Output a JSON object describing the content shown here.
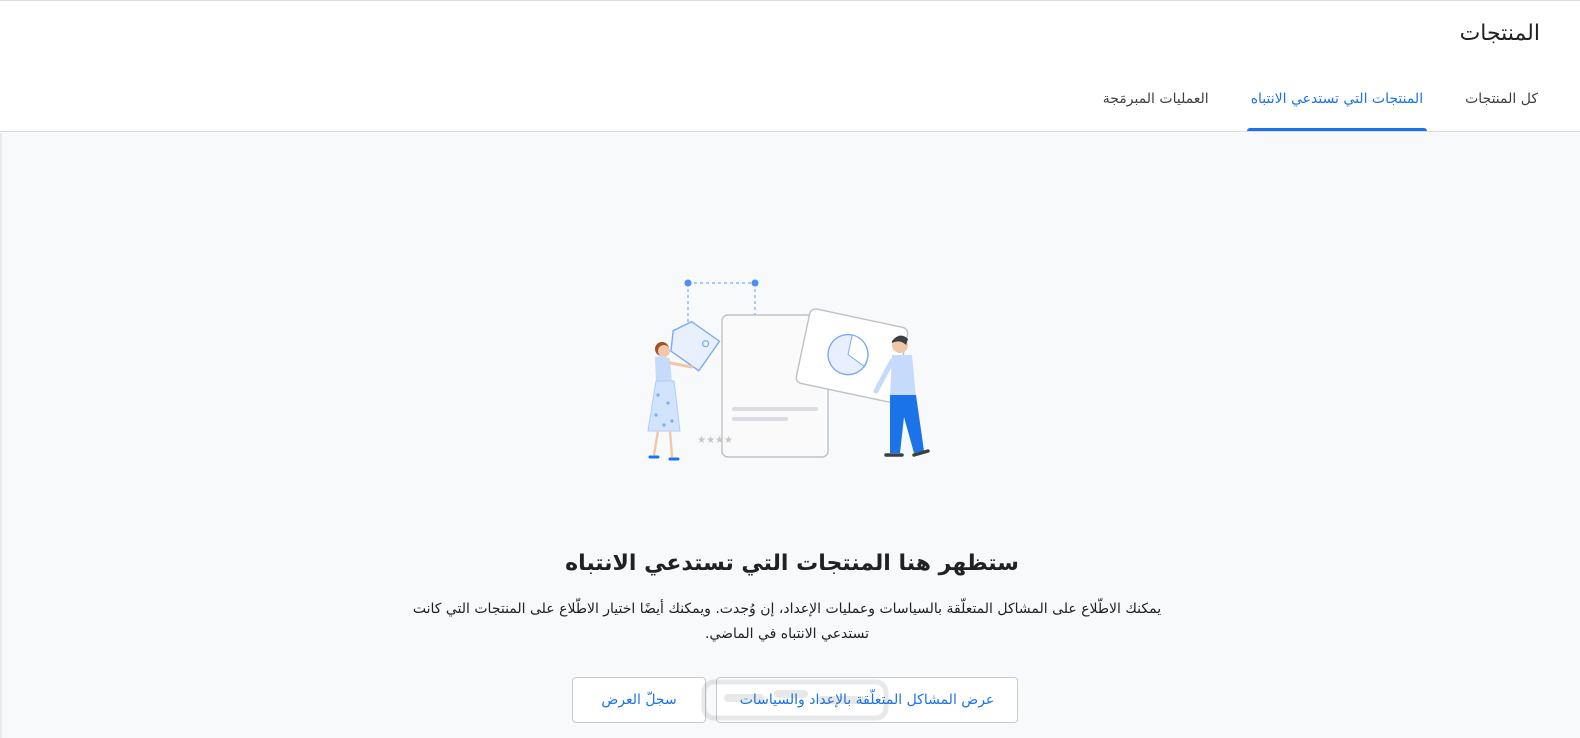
{
  "header": {
    "title": "المنتجات",
    "tabs": [
      {
        "label": "كل المنتجات",
        "active": false
      },
      {
        "label": "المنتجات التي تستدعي الانتباه",
        "active": true
      },
      {
        "label": "العمليات المبرمَجة",
        "active": false
      }
    ]
  },
  "empty_state": {
    "title": "ستظهر هنا المنتجات التي تستدعي الانتباه",
    "description": "يمكنك الاطّلاع على المشاكل المتعلّقة بالسياسات وعمليات الإعداد، إن وُجدت. ويمكنك أيضًا اختيار الاطّلاع على المنتجات التي كانت تستدعي الانتباه في الماضي.",
    "illustration": "empty-state-illustration",
    "buttons": {
      "issues_label": "عرض المشاكل المتعلّقة بالإعداد والسياسات",
      "history_label": "سجلّ العرض"
    }
  },
  "colors": {
    "accent": "#1a73e8",
    "border": "#dadce0",
    "background": "#f8f9fa"
  }
}
